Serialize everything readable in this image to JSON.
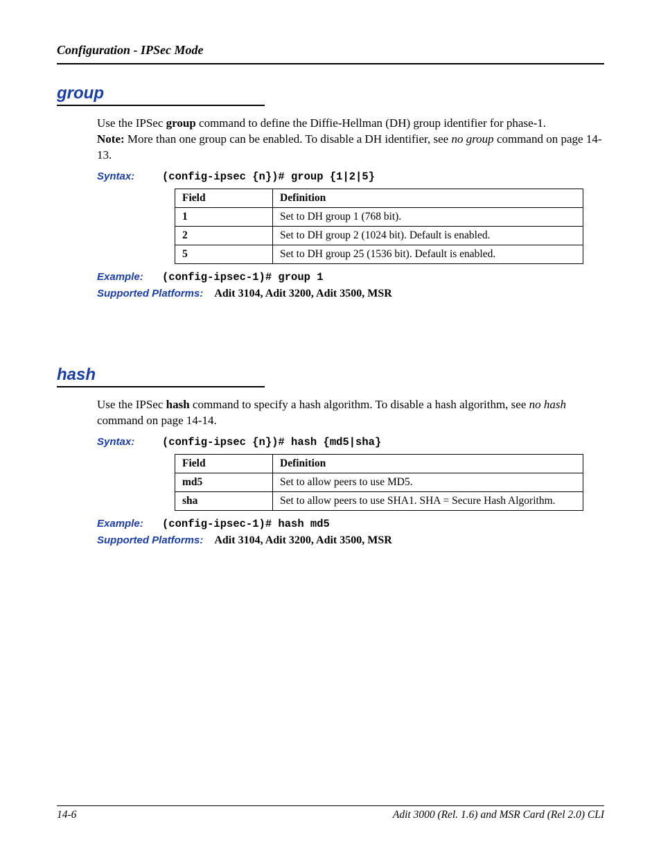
{
  "header": {
    "running": "Configuration - IPSec Mode"
  },
  "sections": [
    {
      "title": "group",
      "para_parts": {
        "p1a": "Use the IPSec ",
        "p1b": "group",
        "p1c": " command to define the Diffie-Hellman (DH) group identifier for phase-1.",
        "p2a": "Note:",
        "p2b": " More than one group can be enabled. To disable a DH identifier, see ",
        "p2c": "no group",
        "p2d": " command on page 14-13."
      },
      "syntax_label": "Syntax:",
      "syntax": "(config-ipsec {n})# group {1|2|5}",
      "table": {
        "headers": [
          "Field",
          "Definition"
        ],
        "rows": [
          [
            "1",
            "Set to DH group 1 (768 bit)."
          ],
          [
            "2",
            "Set to DH group 2 (1024 bit). Default is enabled."
          ],
          [
            "5",
            "Set to DH group 25 (1536 bit). Default is enabled."
          ]
        ]
      },
      "example_label": "Example:",
      "example": "(config-ipsec-1)# group 1",
      "platforms_label": "Supported Platforms:",
      "platforms": "Adit 3104, Adit 3200, Adit 3500, MSR"
    },
    {
      "title": "hash",
      "para_parts": {
        "p1a": "Use the IPSec ",
        "p1b": "hash",
        "p1c": " command to specify a hash algorithm. To disable a hash algorithm, see ",
        "p1d": "no hash",
        "p1e": " command on page 14-14."
      },
      "syntax_label": "Syntax:",
      "syntax": "(config-ipsec {n})# hash {md5|sha}",
      "table": {
        "headers": [
          "Field",
          "Definition"
        ],
        "rows": [
          [
            "md5",
            "Set to allow peers to use MD5."
          ],
          [
            "sha",
            "Set to allow peers to use SHA1.  SHA = Secure Hash Algorithm."
          ]
        ]
      },
      "example_label": "Example:",
      "example": "(config-ipsec-1)# hash md5",
      "platforms_label": "Supported Platforms:",
      "platforms": "Adit 3104, Adit 3200, Adit 3500, MSR"
    }
  ],
  "footer": {
    "left": "14-6",
    "right": "Adit 3000 (Rel. 1.6) and MSR Card (Rel 2.0) CLI"
  }
}
